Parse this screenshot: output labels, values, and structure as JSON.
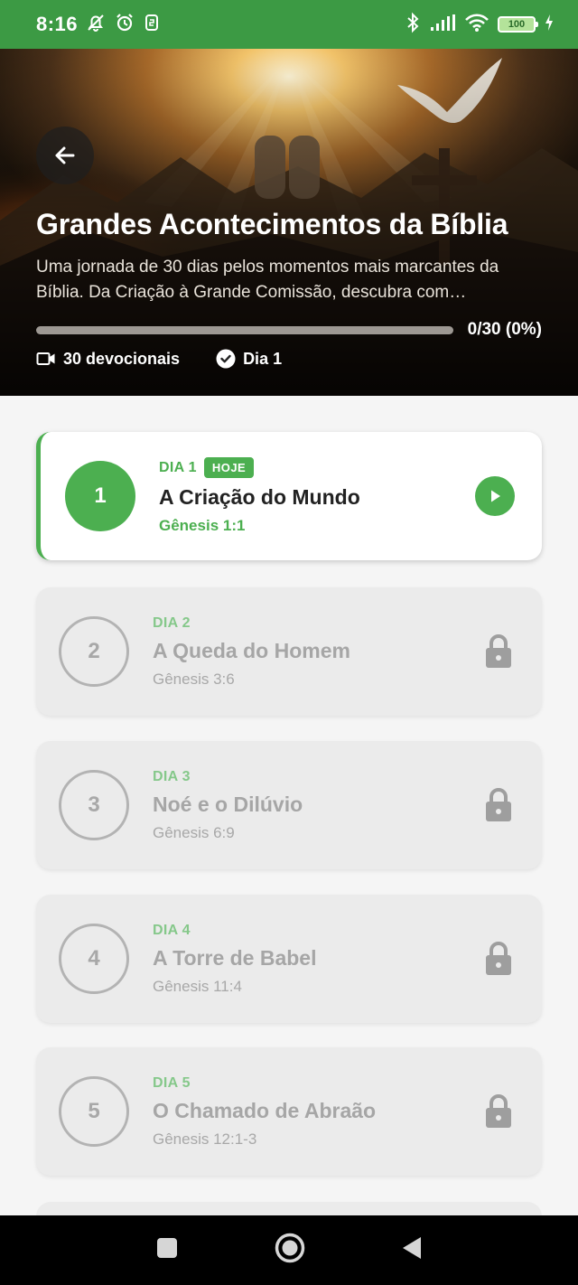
{
  "status_bar": {
    "time": "8:16",
    "battery": "100"
  },
  "hero": {
    "title": "Grandes Acontecimentos da Bíblia",
    "description": "Uma jornada de 30 dias pelos momentos mais marcantes da Bíblia. Da Criação à Grande Comissão, descubra com…",
    "progress": {
      "text": "0/30 (0%)",
      "fraction": 0
    },
    "devotionals_label": "30 devocionais",
    "current_day_label": "Dia 1"
  },
  "days": [
    {
      "number": "1",
      "label": "DIA 1",
      "badge": "HOJE",
      "title": "A Criação do Mundo",
      "reference": "Gênesis 1:1"
    },
    {
      "number": "2",
      "label": "DIA 2",
      "title": "A Queda do Homem",
      "reference": "Gênesis 3:6"
    },
    {
      "number": "3",
      "label": "DIA 3",
      "title": "Noé e o Dilúvio",
      "reference": "Gênesis 6:9"
    },
    {
      "number": "4",
      "label": "DIA 4",
      "title": "A Torre de Babel",
      "reference": "Gênesis 11:4"
    },
    {
      "number": "5",
      "label": "DIA 5",
      "title": "O Chamado de Abraão",
      "reference": "Gênesis 12:1-3"
    }
  ],
  "colors": {
    "status_bar": "#3c9a44",
    "accent": "#4caf50",
    "locked_card": "#ebebeb",
    "background": "#f5f5f5"
  },
  "icons": {
    "back": "arrow-left-icon",
    "devotionals": "video-camera-icon",
    "current_day": "check-circle-icon",
    "play": "play-icon",
    "lock": "lock-icon"
  }
}
